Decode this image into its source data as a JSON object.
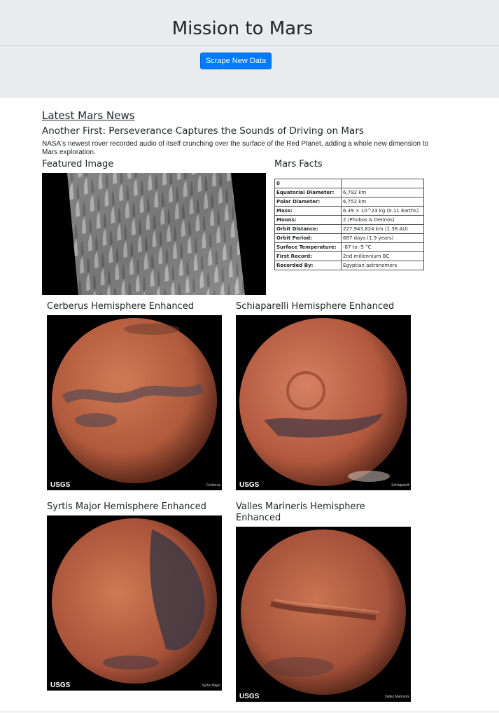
{
  "header": {
    "title": "Mission to Mars",
    "scrape_button": "Scrape New Data"
  },
  "news": {
    "section_title": "Latest Mars News",
    "headline": "Another First: Perseverance Captures the Sounds of Driving on Mars",
    "teaser": "NASA's newest rover recorded audio of itself crunching over the surface of the Red Planet, adding a whole new dimension to Mars exploration."
  },
  "featured": {
    "title": "Featured Image"
  },
  "facts": {
    "title": "Mars Facts",
    "header_cell": "0",
    "rows": [
      {
        "label": "Equatorial Diameter:",
        "value": "6,792 km"
      },
      {
        "label": "Polar Diameter:",
        "value": "6,752 km"
      },
      {
        "label": "Mass:",
        "value": "6.39 × 10^23 kg (0.11 Earths)"
      },
      {
        "label": "Moons:",
        "value": "2 (Phobos & Deimos)"
      },
      {
        "label": "Orbit Distance:",
        "value": "227,943,824 km (1.38 AU)"
      },
      {
        "label": "Orbit Period:",
        "value": "687 days (1.9 years)"
      },
      {
        "label": "Surface Temperature:",
        "value": "-87 to -5 °C"
      },
      {
        "label": "First Record:",
        "value": "2nd millennium BC"
      },
      {
        "label": "Recorded By:",
        "value": "Egyptian astronomers"
      }
    ]
  },
  "hemispheres": [
    {
      "title": "Cerberus Hemisphere Enhanced",
      "logo": "USGS",
      "caption": "Cerberus"
    },
    {
      "title": "Schiaparelli Hemisphere Enhanced",
      "logo": "USGS",
      "caption": "Schiaparelli"
    },
    {
      "title": "Syrtis Major Hemisphere Enhanced",
      "logo": "USGS",
      "caption": "Syrtis Major"
    },
    {
      "title": "Valles Marineris Hemisphere Enhanced",
      "logo": "USGS",
      "caption": "Valles Marineris"
    }
  ],
  "colors": {
    "jumbotron_bg": "#e9ecef",
    "button_bg": "#007bff",
    "mars_base": "#b8573a",
    "mars_dark": "#4a3a3a"
  }
}
